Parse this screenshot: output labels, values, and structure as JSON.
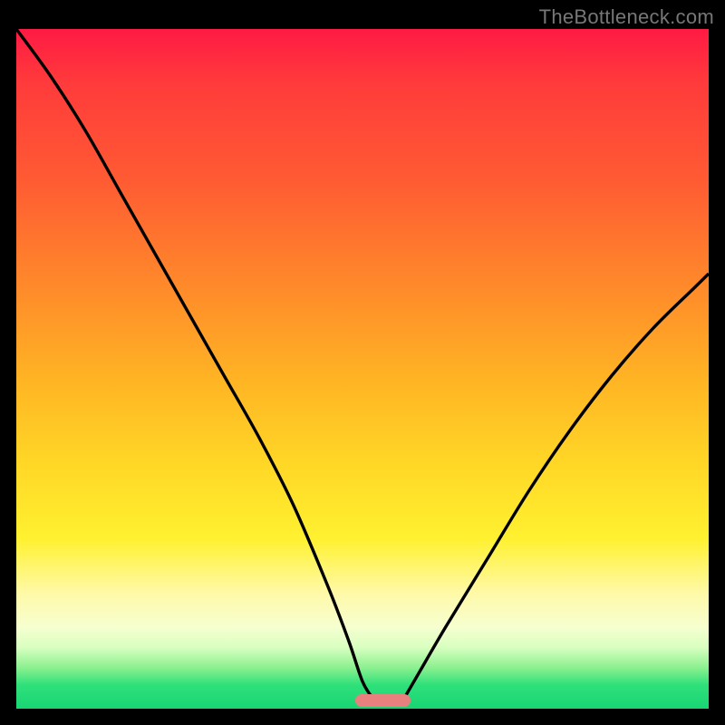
{
  "watermark": "TheBottleneck.com",
  "colors": {
    "gradient_top": "#ff1a44",
    "gradient_mid1": "#ff8a2a",
    "gradient_mid2": "#ffd726",
    "gradient_mid3": "#fff9a8",
    "gradient_bottom": "#18d574",
    "curve": "#000000",
    "marker": "#e98080",
    "frame": "#000000"
  },
  "chart_data": {
    "type": "line",
    "title": "",
    "xlabel": "",
    "ylabel": "",
    "xlim": [
      0,
      100
    ],
    "ylim": [
      0,
      100
    ],
    "series": [
      {
        "name": "left-branch",
        "x": [
          0,
          5,
          10,
          15,
          20,
          25,
          30,
          35,
          40,
          45,
          48,
          50,
          51.5
        ],
        "values": [
          100,
          93,
          85,
          76,
          67,
          58,
          49,
          40,
          30,
          18,
          10,
          4,
          1.5
        ]
      },
      {
        "name": "right-branch",
        "x": [
          56,
          58,
          62,
          68,
          74,
          80,
          86,
          92,
          98,
          100
        ],
        "values": [
          1.5,
          5,
          12,
          22,
          32,
          41,
          49,
          56,
          62,
          64
        ]
      }
    ],
    "annotations": [
      {
        "name": "min-marker",
        "x_start": 49,
        "x_end": 57,
        "y": 1.2
      }
    ]
  }
}
